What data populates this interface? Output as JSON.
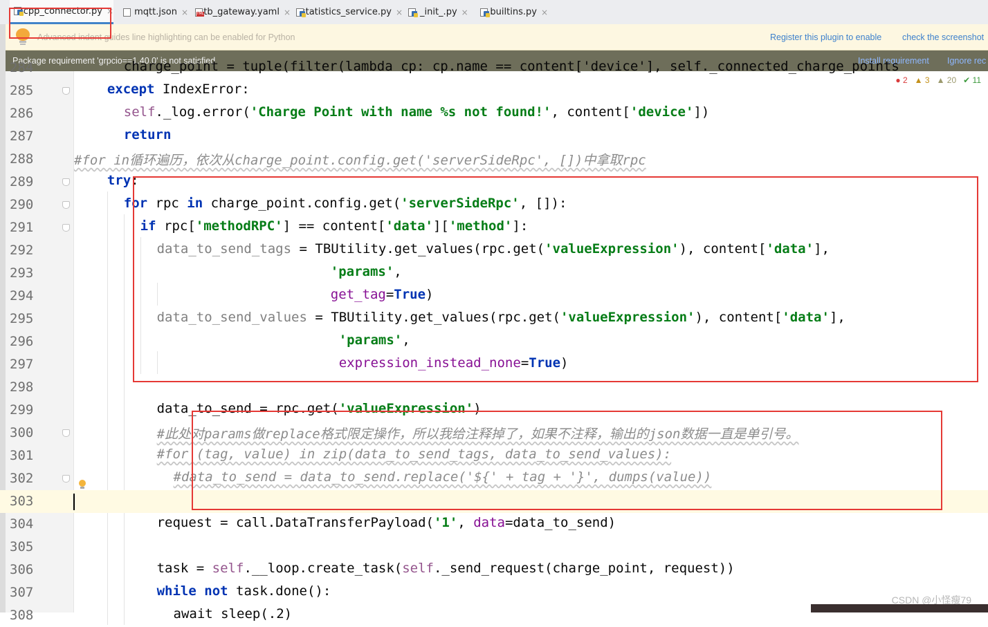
{
  "tabs": [
    {
      "label": "ocpp_connector.py",
      "icon": "python-file-icon",
      "active": true
    },
    {
      "label": "mqtt.json",
      "icon": "json-file-icon"
    },
    {
      "label": "tb_gateway.yaml",
      "icon": "yaml-file-icon"
    },
    {
      "label": "statistics_service.py",
      "icon": "python-file-icon"
    },
    {
      "label": "_init_.py",
      "icon": "python-file-icon"
    },
    {
      "label": "builtins.py",
      "icon": "python-file-icon"
    }
  ],
  "close_glyph": "×",
  "notice_top": {
    "message": "Advanced indent guides line highlighting can be enabled for Python",
    "link1": "Register this plugin to enable",
    "link2": "check the screenshot"
  },
  "notice_requirement": {
    "message": "Package requirement 'grpcio==1.40.0' is not satisfied",
    "link1": "Install requirement",
    "link2": "Ignore rec"
  },
  "inspections": {
    "errors": "2",
    "warnings": "3",
    "weak_warnings": "20",
    "ok": "11"
  },
  "code_lines": [
    {
      "num": "284",
      "indent": 6,
      "tokens": [
        {
          "t": "charge_point = tuple(filter(lambda cp: cp.name == content['device'], self._connected_charge_points",
          "c": "plain"
        }
      ]
    },
    {
      "num": "285",
      "indent": 4,
      "fold": true,
      "tokens": [
        {
          "t": "except",
          "c": "kw"
        },
        {
          "t": " IndexError:",
          "c": "plain"
        }
      ]
    },
    {
      "num": "286",
      "indent": 6,
      "tokens": [
        {
          "t": "self",
          "c": "self"
        },
        {
          "t": "._log.error(",
          "c": "plain"
        },
        {
          "t": "'Charge Point with name %s not found!'",
          "c": "st"
        },
        {
          "t": ", content[",
          "c": "plain"
        },
        {
          "t": "'device'",
          "c": "st"
        },
        {
          "t": "])",
          "c": "plain"
        }
      ]
    },
    {
      "num": "287",
      "indent": 6,
      "tokens": [
        {
          "t": "return",
          "c": "kw"
        }
      ]
    },
    {
      "num": "288",
      "indent": 0,
      "tokens": [
        {
          "t": "#for in循环遍历，依次从charge_point.config.get('serverSideRpc', [])中拿取rpc",
          "c": "cmt"
        }
      ]
    },
    {
      "num": "289",
      "indent": 4,
      "fold": true,
      "tokens": [
        {
          "t": "try",
          "c": "kw"
        },
        {
          "t": ":",
          "c": "plain"
        }
      ]
    },
    {
      "num": "290",
      "indent": 6,
      "fold": true,
      "tokens": [
        {
          "t": "for",
          "c": "kw"
        },
        {
          "t": " rpc ",
          "c": "plain"
        },
        {
          "t": "in",
          "c": "kw"
        },
        {
          "t": " charge_point.config.get(",
          "c": "plain"
        },
        {
          "t": "'serverSideRpc'",
          "c": "st"
        },
        {
          "t": ", []):",
          "c": "plain"
        }
      ]
    },
    {
      "num": "291",
      "indent": 8,
      "fold": true,
      "tokens": [
        {
          "t": "if",
          "c": "kw"
        },
        {
          "t": " rpc[",
          "c": "plain"
        },
        {
          "t": "'methodRPC'",
          "c": "st"
        },
        {
          "t": "] == content[",
          "c": "plain"
        },
        {
          "t": "'data'",
          "c": "st"
        },
        {
          "t": "][",
          "c": "plain"
        },
        {
          "t": "'method'",
          "c": "st"
        },
        {
          "t": "]:",
          "c": "plain"
        }
      ]
    },
    {
      "num": "292",
      "indent": 10,
      "tokens": [
        {
          "t": "data_to_send_tags",
          "c": "unused"
        },
        {
          "t": " = TBUtility.get_values(rpc.get(",
          "c": "plain"
        },
        {
          "t": "'valueExpression'",
          "c": "st"
        },
        {
          "t": "), content[",
          "c": "plain"
        },
        {
          "t": "'data'",
          "c": "st"
        },
        {
          "t": "],",
          "c": "plain"
        }
      ]
    },
    {
      "num": "293",
      "indent": 31,
      "tokens": [
        {
          "t": "'params'",
          "c": "st"
        },
        {
          "t": ",",
          "c": "plain"
        }
      ]
    },
    {
      "num": "294",
      "indent": 31,
      "tokens": [
        {
          "t": "get_tag",
          "c": "kwarg"
        },
        {
          "t": "=",
          "c": "plain"
        },
        {
          "t": "True",
          "c": "kw"
        },
        {
          "t": ")",
          "c": "plain"
        }
      ]
    },
    {
      "num": "295",
      "indent": 10,
      "tokens": [
        {
          "t": "data_to_send_values",
          "c": "unused"
        },
        {
          "t": " = TBUtility.get_values(rpc.get(",
          "c": "plain"
        },
        {
          "t": "'valueExpression'",
          "c": "st"
        },
        {
          "t": "), content[",
          "c": "plain"
        },
        {
          "t": "'data'",
          "c": "st"
        },
        {
          "t": "],",
          "c": "plain"
        }
      ]
    },
    {
      "num": "296",
      "indent": 32,
      "tokens": [
        {
          "t": "'params'",
          "c": "st"
        },
        {
          "t": ",",
          "c": "plain"
        }
      ]
    },
    {
      "num": "297",
      "indent": 32,
      "tokens": [
        {
          "t": "expression_instead_none",
          "c": "kwarg"
        },
        {
          "t": "=",
          "c": "plain"
        },
        {
          "t": "True",
          "c": "kw"
        },
        {
          "t": ")",
          "c": "plain"
        }
      ]
    },
    {
      "num": "298",
      "indent": 0,
      "tokens": []
    },
    {
      "num": "299",
      "indent": 10,
      "tokens": [
        {
          "t": "data_to_send = rpc.get(",
          "c": "plain"
        },
        {
          "t": "'valueExpression'",
          "c": "st"
        },
        {
          "t": ")",
          "c": "plain"
        }
      ]
    },
    {
      "num": "300",
      "indent": 10,
      "fold": true,
      "tokens": [
        {
          "t": "#此处对params做replace格式限定操作，所以我给注释掉了，如果不注释，输出的json数据一直是单引号。",
          "c": "cmt"
        }
      ]
    },
    {
      "num": "301",
      "indent": 10,
      "tokens": [
        {
          "t": "#for (tag, value) in zip(data_to_send_tags, data_to_send_values):",
          "c": "cmt"
        }
      ]
    },
    {
      "num": "302",
      "indent": 12,
      "fold": true,
      "tokens": [
        {
          "t": "#data_to_send = data_to_send.replace('${' + tag + '}', dumps(value))",
          "c": "cmt"
        }
      ]
    },
    {
      "num": "303",
      "indent": 0,
      "current": true,
      "tokens": []
    },
    {
      "num": "304",
      "indent": 10,
      "tokens": [
        {
          "t": "request = call.DataTransferPayload(",
          "c": "plain"
        },
        {
          "t": "'1'",
          "c": "st"
        },
        {
          "t": ", ",
          "c": "plain"
        },
        {
          "t": "data",
          "c": "kwarg"
        },
        {
          "t": "=data_to_send)",
          "c": "plain"
        }
      ]
    },
    {
      "num": "305",
      "indent": 0,
      "tokens": []
    },
    {
      "num": "306",
      "indent": 10,
      "tokens": [
        {
          "t": "task = ",
          "c": "plain"
        },
        {
          "t": "self",
          "c": "self"
        },
        {
          "t": ".__loop.create_task(",
          "c": "plain"
        },
        {
          "t": "self",
          "c": "self"
        },
        {
          "t": "._send_request(charge_point, request))",
          "c": "plain"
        }
      ]
    },
    {
      "num": "307",
      "indent": 10,
      "tokens": [
        {
          "t": "while",
          "c": "kw"
        },
        {
          "t": " ",
          "c": "plain"
        },
        {
          "t": "not",
          "c": "kw"
        },
        {
          "t": " task.done():",
          "c": "plain"
        }
      ]
    },
    {
      "num": "308",
      "indent": 12,
      "tokens": [
        {
          "t": "await sleep(.2)",
          "c": "plain"
        }
      ]
    }
  ],
  "watermark": "CSDN @小怪瘦79",
  "colors": {
    "annotation_box": "#e53935",
    "keyword": "#0033b3",
    "string": "#067d17",
    "comment": "#8c8c8c"
  }
}
